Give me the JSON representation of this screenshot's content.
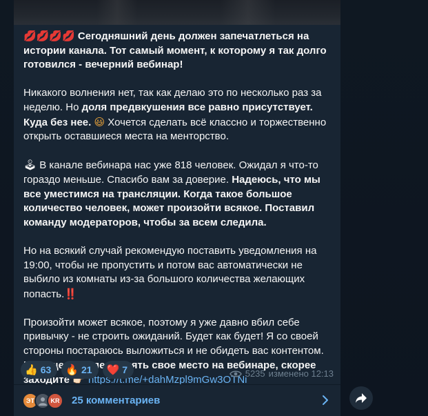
{
  "post": {
    "p1_emoji": "💋💋💋💋",
    "p1_text": "Сегодняшний день должен запечатлеться на истории канала. Тот самый момент, к которому я так долго готовился - вечерний вебинар!",
    "p2_a": "Никакого волнения нет, так как делаю это по несколько раз за неделю. Но ",
    "p2_b": "доля предвкушения все равно присутствует. Куда без нее.",
    "p2_emoji": "😃",
    "p2_c": "Хочется сделать всё классно и торжественно открыть оставшиеся места на менторство.",
    "p3_emoji": "🕹",
    "p3_a": "В канале вебинара нас уже 818 человек. Ожидал я что-то гораздо меньше. Спасибо вам за доверие. ",
    "p3_b": "Надеюсь, что мы все уместимся на трансляции. Когда такое большое количество человек, может произойти всякое. Поставил команду модераторов, чтобы за всем следила.",
    "p4_a": "Но на всякий случай рекомендую поставить уведомления на 19:00, чтобы не пропустить и потом вас автоматически не выбило из комнаты из-за большого количества желающих попасть.",
    "p4_emoji": "‼️",
    "p5_a": "Произойти может всякое, поэтому я уже давно вбил себе привычку - не строить ожиданий. Будет как будет! Я со своей стороны постараюсь выложиться и не обидеть вас контентом. ",
    "p5_b": "Кто еще не успел занять свое место на вебинаре, скорее заходите",
    "p5_emoji": "👉🏻",
    "link": "https://t.me/+dahMzpl9mGw3OTNi"
  },
  "reactions": [
    {
      "icon": "👍",
      "count": "63",
      "icon_name": "thumbs-up-icon"
    },
    {
      "icon": "🔥",
      "count": "21",
      "icon_name": "fire-icon"
    },
    {
      "icon": "❤️",
      "count": "7",
      "icon_name": "heart-icon"
    }
  ],
  "meta": {
    "views": "5235",
    "edited_time": "изменено 12:13"
  },
  "comments": {
    "label": "25 комментариев",
    "avatars": [
      "ЭТ",
      "",
      "KR"
    ]
  },
  "colors": {
    "bubble": "#182533",
    "link": "#6ab3f3",
    "meta": "#6d7f8f",
    "background": "#0e1621"
  }
}
